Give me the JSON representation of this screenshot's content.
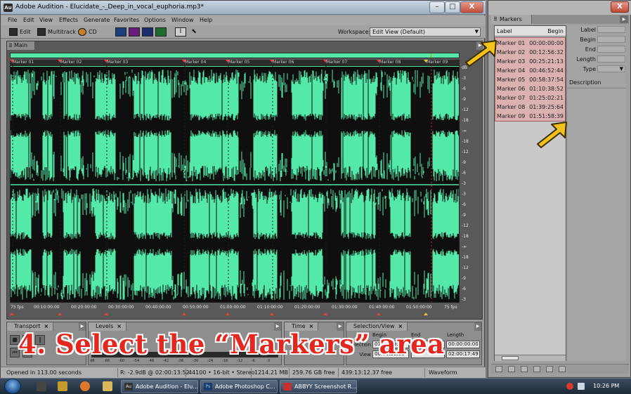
{
  "window": {
    "app_icon_text": "Au",
    "title": "Adobe Audition - Elucidate_-_Deep_in_vocal_euphoria.mp3*",
    "min_glyph": "–",
    "max_glyph": "□",
    "close_glyph": "X"
  },
  "menu": [
    "File",
    "Edit",
    "View",
    "Effects",
    "Generate",
    "Favorites",
    "Options",
    "Window",
    "Help"
  ],
  "toolbar": {
    "edit_label": "Edit",
    "multitrack_label": "Multitrack",
    "cd_label": "CD",
    "workspace_label": "Workspace:",
    "workspace_value": "Edit View (Default)"
  },
  "main_panel": {
    "tab_label": "Main",
    "marker_labels": [
      "Marker 01",
      "Marker 02",
      "Marker 03",
      "Marker 04",
      "Marker 05",
      "Marker 06",
      "Marker 07",
      "Marker 08",
      "Marker 09"
    ],
    "db_ticks": [
      "dB",
      "-3",
      "-6",
      "-9",
      "-12",
      "-18",
      "-∞",
      "-18",
      "-12",
      "-9",
      "-6",
      "-3",
      "-3",
      "-6",
      "-9",
      "-12",
      "-18",
      "-∞",
      "-18",
      "-12",
      "-9",
      "-6",
      "-3"
    ],
    "time_ticks": [
      "75 fps",
      "00:10:00:00",
      "00:20:00:00",
      "00:30:00:00",
      "00:40:00:00",
      "00:50:00:00",
      "01:00:00:00",
      "01:10:00:00",
      "01:20:00:00",
      "01:30:00:00",
      "01:40:00:00",
      "01:50:00:00",
      "75 fps"
    ]
  },
  "panels": {
    "transport": "Transport",
    "levels": "Levels",
    "time": "Time",
    "selection_view": "Selection/View",
    "sel_begin_label": "Begin",
    "sel_end_label": "End",
    "sel_length_label": "Length",
    "sel_selection_label": "Selection",
    "sel_view_label": "View",
    "sel_begin_value": "01:51:58:39",
    "sel_view_begin_value": "00:00:00:00",
    "sel_length_value": "00:00:00:00",
    "sel_view_length_value": "02:00:17:49",
    "level_ticks": [
      "dB",
      "-66",
      "-60",
      "-54",
      "-48",
      "-42",
      "-36",
      "-30",
      "-24",
      "-18",
      "-12",
      "-6",
      "0"
    ]
  },
  "status": {
    "opened": "Opened in 113.00 seconds",
    "cursor": "R: -2.9dB @ 02:00:13:52",
    "format": "44100 • 16-bit • Stereo",
    "size": "1214.21 MB",
    "disk_free": "259.76 GB free",
    "time_free": "439:13:12.37 free",
    "view_mode": "Waveform"
  },
  "markers_window": {
    "close_glyph": "X",
    "tab_label": "Markers",
    "col_label": "Label",
    "col_begin": "Begin",
    "rows": [
      {
        "label": "Marker 01",
        "begin": "00:00:00:00"
      },
      {
        "label": "Marker 02",
        "begin": "00:12:56:32"
      },
      {
        "label": "Marker 03",
        "begin": "00:25:21:13"
      },
      {
        "label": "Marker 04",
        "begin": "00:46:52:44"
      },
      {
        "label": "Marker 05",
        "begin": "00:58:37:54"
      },
      {
        "label": "Marker 06",
        "begin": "01:10:38:52"
      },
      {
        "label": "Marker 07",
        "begin": "01:25:02:21"
      },
      {
        "label": "Marker 08",
        "begin": "01:39:25:64"
      },
      {
        "label": "Marker 09",
        "begin": "01:51:58:39"
      }
    ],
    "props": {
      "label": "Label",
      "begin": "Begin",
      "end": "End",
      "length": "Length",
      "type": "Type",
      "description": "Description"
    }
  },
  "caption": "4. Select the “Markers” area",
  "taskbar": {
    "tasks": [
      "Adobe Audition - Elu...",
      "Adobe Photoshop C...",
      "ABBYY Screenshot R..."
    ],
    "task_icons": [
      "Au",
      "Ps",
      ""
    ],
    "clock": "10:26 PM"
  },
  "colors": {
    "waveform_bg": "#55e9a9",
    "marker_highlight": "#dcb1b2",
    "caption": "#e3261f",
    "arrow": "#f3c21c"
  }
}
